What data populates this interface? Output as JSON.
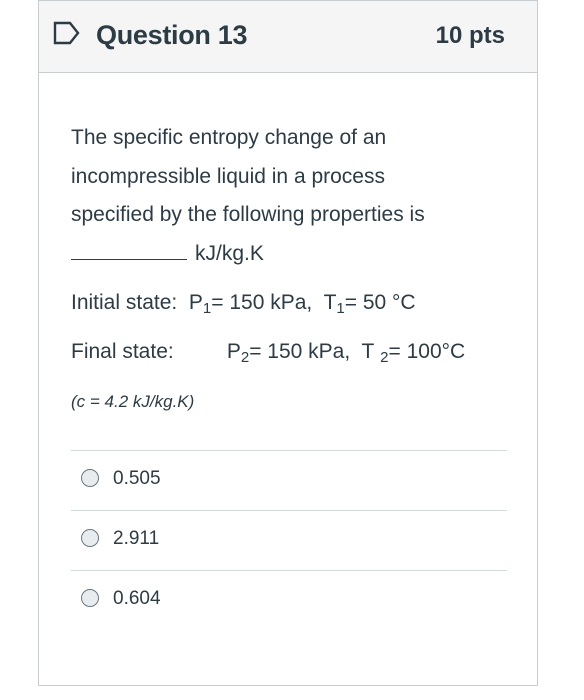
{
  "question": {
    "title": "Question 13",
    "points": "10 pts",
    "prompt_lines": [
      "The specific entropy change of an",
      "incompressible liquid in a process",
      "specified by the following properties is"
    ],
    "blank_units": "kJ/kg.K",
    "initial_state": {
      "label": "Initial state:",
      "p_symbol": "P",
      "p_sub": "1",
      "p_value": "= 150 kPa,",
      "t_symbol": "T",
      "t_sub": "1",
      "t_value": "= 50 °C"
    },
    "final_state": {
      "label": "Final state:",
      "p_symbol": "P",
      "p_sub": "2",
      "p_value": "= 150 kPa,",
      "t_symbol": "T",
      "t_sub": "2",
      "t_value": "= 100°C"
    },
    "note": "(c = 4.2 kJ/kg.K)"
  },
  "answers": [
    {
      "label": "0.505"
    },
    {
      "label": "2.911"
    },
    {
      "label": "0.604"
    }
  ],
  "icons": {
    "flag": "bookmark-flag-icon",
    "radio": "radio-button-icon"
  },
  "colors": {
    "text": "#2d3b45",
    "header_bg": "#f5f5f5",
    "border": "#c7cdd1",
    "flag": "#2d3b45"
  }
}
